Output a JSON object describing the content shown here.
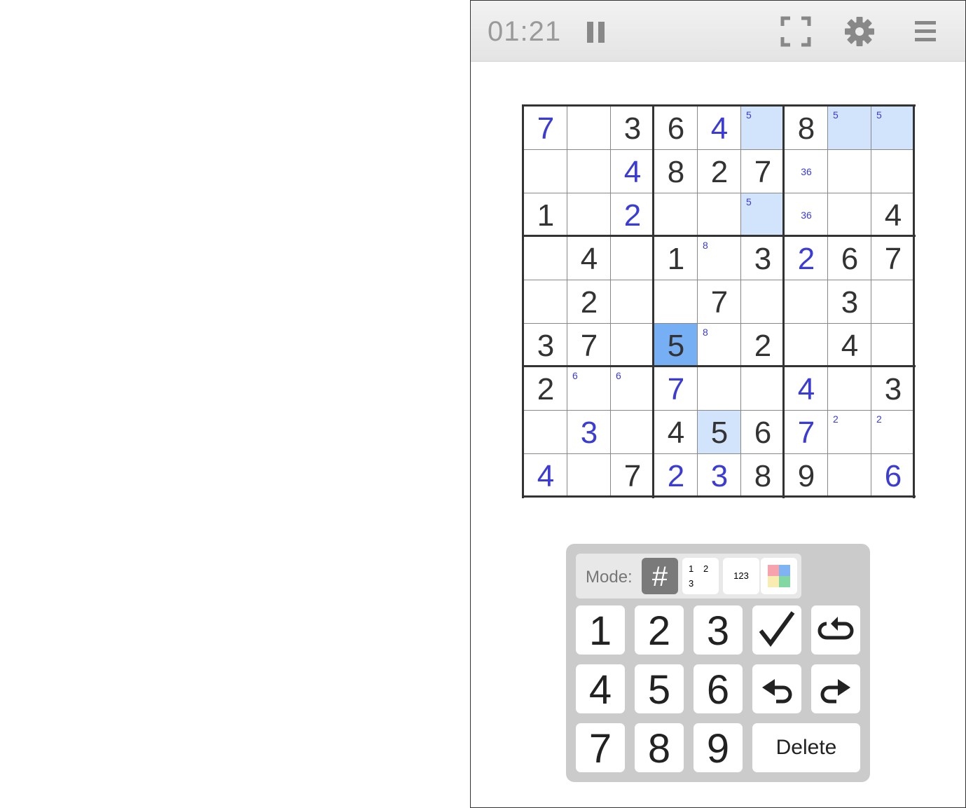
{
  "timer": "01:21",
  "icons": {
    "pause": "pause-icon",
    "fullscreen": "fullscreen-icon",
    "settings": "gear-icon",
    "menu": "hamburger-menu-icon"
  },
  "colors": {
    "given": "#333333",
    "user_entry": "#3b3bd6",
    "highlight_light": "#d2e4fb",
    "highlight_selected": "#77aff5"
  },
  "board": [
    [
      {
        "v": "7",
        "u": true
      },
      {
        "v": ""
      },
      {
        "v": "3"
      },
      {
        "v": "6"
      },
      {
        "v": "4",
        "u": true
      },
      {
        "n": "5",
        "h": "light"
      },
      {
        "v": "8"
      },
      {
        "n": "5",
        "h": "light"
      },
      {
        "n": "5",
        "h": "light"
      }
    ],
    [
      {
        "v": ""
      },
      {
        "v": ""
      },
      {
        "v": "4",
        "u": true
      },
      {
        "v": "8"
      },
      {
        "v": "2"
      },
      {
        "v": "7"
      },
      {
        "c": "36"
      },
      {
        "v": ""
      },
      {
        "v": ""
      }
    ],
    [
      {
        "v": "1"
      },
      {
        "v": ""
      },
      {
        "v": "2",
        "u": true
      },
      {
        "v": ""
      },
      {
        "v": ""
      },
      {
        "n": "5",
        "h": "light"
      },
      {
        "c": "36"
      },
      {
        "v": ""
      },
      {
        "v": "4"
      }
    ],
    [
      {
        "v": ""
      },
      {
        "v": "4"
      },
      {
        "v": ""
      },
      {
        "v": "1"
      },
      {
        "n": "8"
      },
      {
        "v": "3"
      },
      {
        "v": "2",
        "u": true
      },
      {
        "v": "6"
      },
      {
        "v": "7"
      }
    ],
    [
      {
        "v": ""
      },
      {
        "v": "2"
      },
      {
        "v": ""
      },
      {
        "v": ""
      },
      {
        "v": "7"
      },
      {
        "v": ""
      },
      {
        "v": ""
      },
      {
        "v": "3"
      },
      {
        "v": ""
      }
    ],
    [
      {
        "v": "3"
      },
      {
        "v": "7"
      },
      {
        "v": ""
      },
      {
        "v": "5",
        "h": "selected"
      },
      {
        "n": "8"
      },
      {
        "v": "2"
      },
      {
        "v": ""
      },
      {
        "v": "4"
      },
      {
        "v": ""
      }
    ],
    [
      {
        "v": "2"
      },
      {
        "n": "6"
      },
      {
        "n": "6"
      },
      {
        "v": "7",
        "u": true
      },
      {
        "v": ""
      },
      {
        "v": ""
      },
      {
        "v": "4",
        "u": true
      },
      {
        "v": ""
      },
      {
        "v": "3"
      }
    ],
    [
      {
        "v": ""
      },
      {
        "v": "3",
        "u": true
      },
      {
        "v": ""
      },
      {
        "v": "4"
      },
      {
        "v": "5",
        "h": "light"
      },
      {
        "v": "6"
      },
      {
        "v": "7",
        "u": true
      },
      {
        "n": "2"
      },
      {
        "n": "2"
      }
    ],
    [
      {
        "v": "4",
        "u": true
      },
      {
        "v": ""
      },
      {
        "v": "7"
      },
      {
        "v": "2",
        "u": true
      },
      {
        "v": "3",
        "u": true
      },
      {
        "v": "8"
      },
      {
        "v": "9"
      },
      {
        "v": ""
      },
      {
        "v": "6",
        "u": true
      }
    ]
  ],
  "pad": {
    "mode_label": "Mode:",
    "modes": {
      "normal": "#",
      "corner_digits": [
        "1",
        "2",
        "3"
      ],
      "center": "123",
      "color": "color-mode-icon"
    },
    "digits": [
      "1",
      "2",
      "3",
      "4",
      "5",
      "6",
      "7",
      "8",
      "9"
    ],
    "check_icon": "checkmark-icon",
    "restart_icon": "restart-icon",
    "undo_icon": "undo-icon",
    "redo_icon": "redo-icon",
    "delete_label": "Delete"
  }
}
